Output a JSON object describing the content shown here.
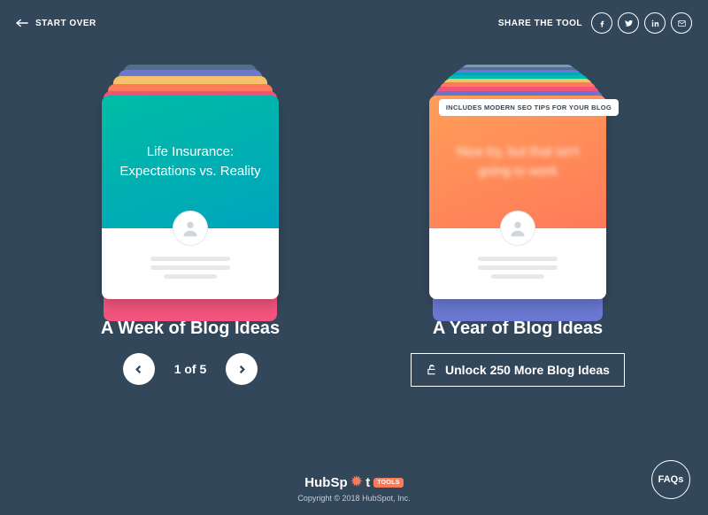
{
  "header": {
    "start_over": "START OVER",
    "share_label": "SHARE THE TOOL"
  },
  "week": {
    "title": "A Week of Blog Ideas",
    "card_title": "Life Insurance: Expectations vs. Reality",
    "pager": "1 of 5"
  },
  "year": {
    "title": "A Year of Blog Ideas",
    "badge": "INCLUDES MODERN SEO TIPS FOR YOUR BLOG",
    "card_title": "Nice try, but that isn't going to work",
    "unlock": "Unlock 250 More Blog Ideas"
  },
  "footer": {
    "logo_main": "HubSp",
    "logo_tail": "t",
    "tools": "TOOLS",
    "copyright": "Copyright © 2018 HubSpot, Inc."
  },
  "faq": "FAQs"
}
